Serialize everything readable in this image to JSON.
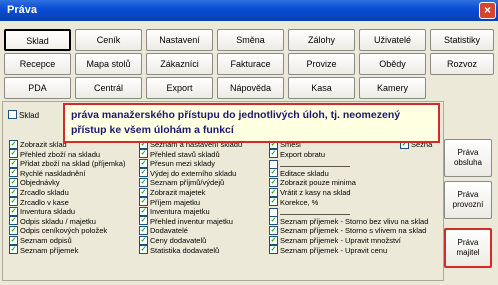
{
  "window": {
    "title": "Práva",
    "close": "×"
  },
  "tabs_row1": [
    "Sklad",
    "Ceník",
    "Nastavení",
    "Směna",
    "Zálohy",
    "Uživatelé",
    "Statistiky"
  ],
  "tabs_row2": [
    "Recepce",
    "Mapa stolů",
    "Zákazníci",
    "Fakturace",
    "Provize",
    "Obědy",
    "Rozvoz"
  ],
  "tabs_row3": [
    "PDA",
    "Centrál",
    "Export",
    "Nápověda",
    "Kasa",
    "Kamery"
  ],
  "active_tab": "Sklad",
  "sklad_checkbox": {
    "label": "Sklad",
    "checked": false
  },
  "tooltip": {
    "line1": "práva manažerského přístupu do jednotlivých úloh, tj. neomezený",
    "line2": "přístup ke všem úlohám a funkcí"
  },
  "partial_label": "Sezna",
  "col1": [
    {
      "label": "Zobrazit sklad",
      "checked": true
    },
    {
      "label": "Přehled zboží na skladu",
      "checked": true
    },
    {
      "label": "Přidat zboží na sklad (příjemka)",
      "checked": true
    },
    {
      "label": "Rychlé naskladnění",
      "checked": true
    },
    {
      "label": "Objednávky",
      "checked": true
    },
    {
      "label": "Zrcadlo skladu",
      "checked": true
    },
    {
      "label": "Zrcadlo v kase",
      "checked": true
    },
    {
      "label": "Inventura skladu",
      "checked": true
    },
    {
      "label": "Odpis skladu / majetku",
      "checked": true
    },
    {
      "label": "Odpis ceníkových položek",
      "checked": true
    },
    {
      "label": "Seznam odpisů",
      "checked": true
    },
    {
      "label": "Seznam příjemek",
      "checked": true
    }
  ],
  "col2": [
    {
      "label": "Seznam a nastavení skladů",
      "checked": true
    },
    {
      "label": "Přehled stavů skladů",
      "checked": true
    },
    {
      "label": "Přesun mezi sklady",
      "checked": true
    },
    {
      "label": "Výdej do externího skladu",
      "checked": true
    },
    {
      "label": "Seznam příjmů/výdejů",
      "checked": true
    },
    {
      "label": "Zobrazit majetek",
      "checked": true
    },
    {
      "label": "Příjem majetku",
      "checked": true
    },
    {
      "label": "Inventura majetku",
      "checked": true
    },
    {
      "label": "Přehled inventur majetku",
      "checked": true
    },
    {
      "label": "Dodavatelé",
      "checked": true
    },
    {
      "label": "Ceny dodavatelů",
      "checked": true
    },
    {
      "label": "Statistika dodavatelů",
      "checked": true
    }
  ],
  "col3": [
    {
      "label": "Směsi",
      "checked": true
    },
    {
      "label": "Export obratu",
      "checked": true
    },
    {
      "label": "",
      "checked": false,
      "blank": true
    },
    {
      "label": "Editace skladu",
      "checked": true
    },
    {
      "label": "Zobrazit pouze minima",
      "checked": true
    },
    {
      "label": "Vrátit z kasy na sklad",
      "checked": true
    },
    {
      "label": "Korekce, %",
      "checked": true
    },
    {
      "label": "",
      "checked": false,
      "blank": true
    },
    {
      "label": "Seznam příjemek - Storno bez vlivu na sklad",
      "checked": true
    },
    {
      "label": "Seznam příjemek - Storno s vlivem na sklad",
      "checked": true
    },
    {
      "label": "Seznam příjemek - Upravit množství",
      "checked": true
    },
    {
      "label": "Seznam příjemek - Upravit cenu",
      "checked": true
    }
  ],
  "right_buttons": [
    {
      "line1": "Práva",
      "line2": "obsluha"
    },
    {
      "line1": "Práva",
      "line2": "provozní"
    },
    {
      "line1": "Práva",
      "line2": "majitel"
    }
  ],
  "check_glyph": "✓"
}
